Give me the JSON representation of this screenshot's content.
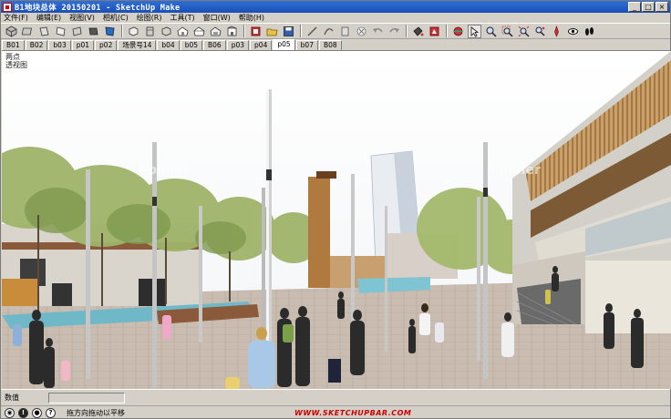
{
  "window": {
    "title": "B1地块总体 20150201 - SketchUp Make",
    "controls": [
      "_",
      "□",
      "×"
    ]
  },
  "menu": [
    "文件(F)",
    "编辑(E)",
    "视图(V)",
    "相机(C)",
    "绘图(R)",
    "工具(T)",
    "窗口(W)",
    "帮助(H)"
  ],
  "toolbar": {
    "groups": [
      [
        "iso-view-icon",
        "top-view-icon",
        "front-view-icon",
        "right-view-icon",
        "back-view-icon",
        "left-view-icon",
        "bottom-view-icon"
      ],
      [
        "xray-icon",
        "back-edges-icon",
        "wireframe-icon",
        "hidden-line-icon",
        "shaded-icon",
        "shaded-textures-icon",
        "monochrome-icon"
      ],
      [
        "warehouse-icon",
        "open-icon",
        "save-icon"
      ],
      [
        "line-icon",
        "arc-icon",
        "rectangle-icon",
        "eraser-icon",
        "undo-icon",
        "redo-icon"
      ],
      [
        "paint-bucket-icon",
        "components-icon"
      ],
      [
        "orbit-icon",
        "select-icon",
        "zoom-icon",
        "zoom-window-icon",
        "zoom-extents-icon",
        "pan-icon",
        "position-camera-icon",
        "look-around-icon",
        "walk-icon"
      ]
    ]
  },
  "scenes": {
    "tabs": [
      "B01",
      "B02",
      "b03",
      "p01",
      "p02",
      "场景号14",
      "b04",
      "b05",
      "B06",
      "p03",
      "p04",
      "p05",
      "b07",
      "B08"
    ],
    "active_index": 11
  },
  "viewport": {
    "label_line1": "两点",
    "label_line2": "透视图"
  },
  "measurements": {
    "label": "数值",
    "value": ""
  },
  "status": {
    "hint": "拖方向拖动以平移",
    "watermark": "WWW.SKETCHUPBAR.COM"
  }
}
